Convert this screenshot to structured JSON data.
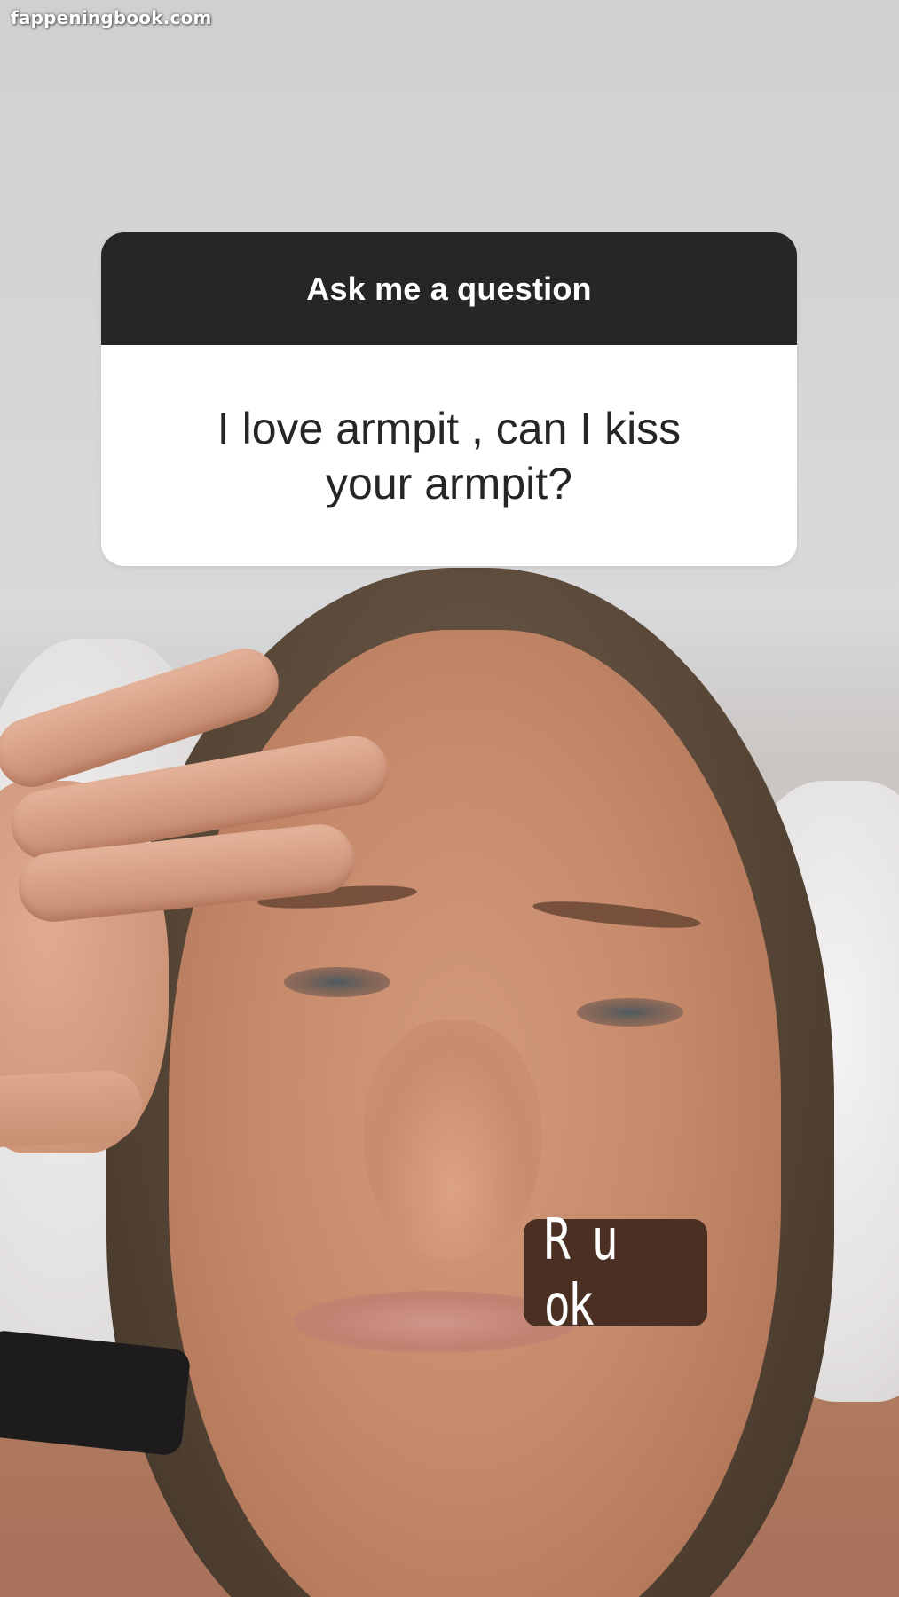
{
  "watermark": {
    "text": "fappeningbook.com"
  },
  "question_sticker": {
    "header": "Ask me a question",
    "question": "I love armpit , can I kiss\nyour armpit?"
  },
  "reply_sticker": {
    "text": "R u ok"
  },
  "colors": {
    "header_bg": "#262626",
    "card_bg": "#ffffff",
    "reply_bg": "#4a2f22"
  }
}
